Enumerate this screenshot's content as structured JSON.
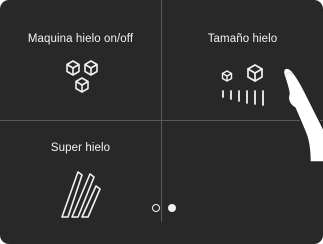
{
  "tiles": [
    {
      "label": "Maquina hielo on/off",
      "icon": "ice-cubes-icon"
    },
    {
      "label": "Tamaño hielo",
      "icon": "ice-size-icon"
    },
    {
      "label": "Super hielo",
      "icon": "super-ice-icon"
    }
  ],
  "pager": {
    "pages": 2,
    "current_page": 2
  },
  "colors": {
    "background": "#282828",
    "divider": "#5a5a5a",
    "foreground": "#f2f2f2"
  }
}
